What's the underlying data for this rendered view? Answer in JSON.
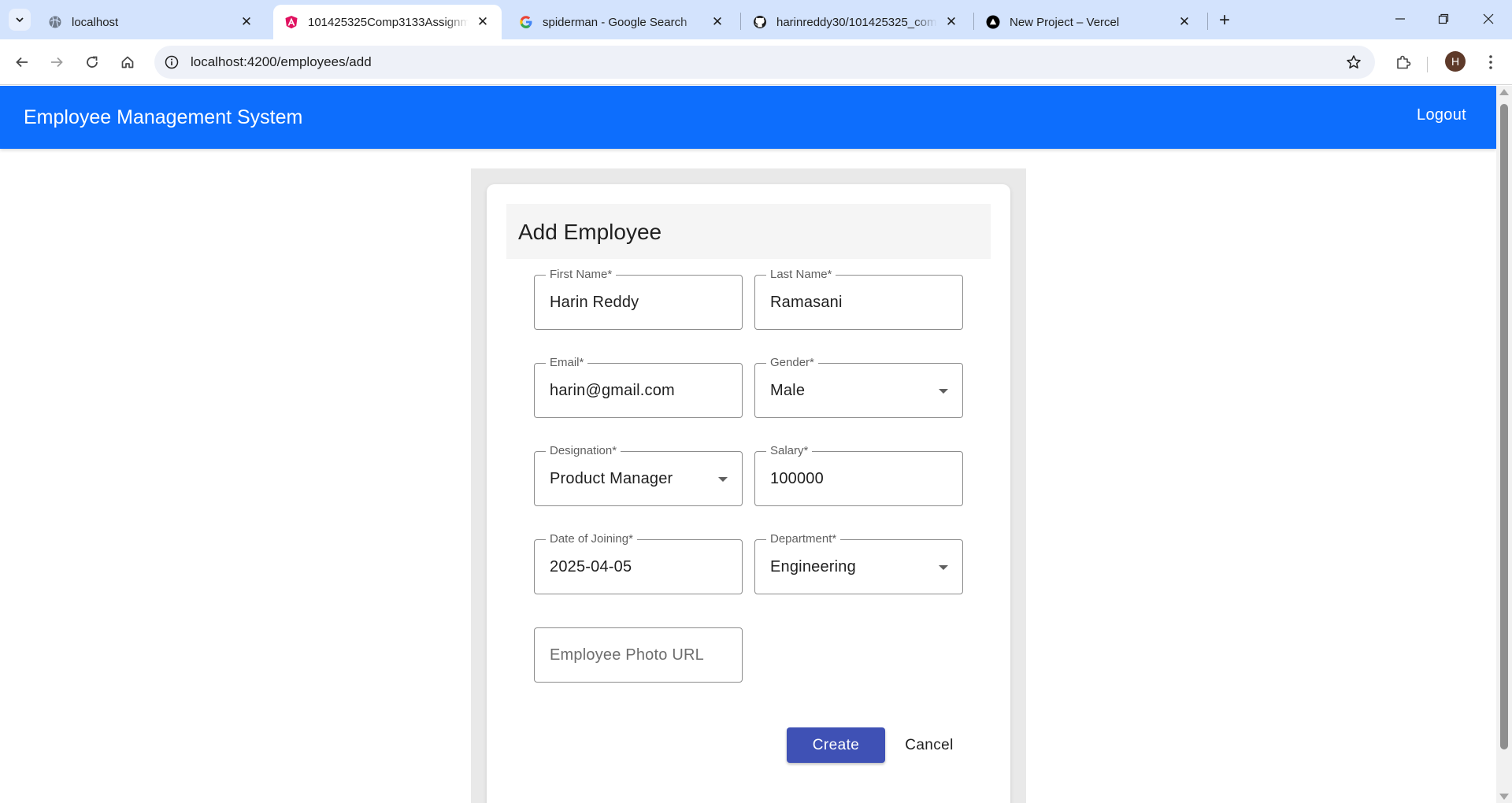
{
  "browser": {
    "tabs": [
      {
        "title": "localhost",
        "icon": "globe-icon",
        "active": false
      },
      {
        "title": "101425325Comp3133Assignme",
        "icon": "angular-icon",
        "active": true
      },
      {
        "title": "spiderman - Google Search",
        "icon": "google-icon",
        "active": false
      },
      {
        "title": "harinreddy30/101425325_comp",
        "icon": "github-icon",
        "active": false
      },
      {
        "title": "New Project – Vercel",
        "icon": "vercel-icon",
        "active": false
      }
    ],
    "url": "localhost:4200/employees/add",
    "profile_initial": "H",
    "tab_strip_color": "#d3e3fd"
  },
  "app": {
    "title": "Employee Management System",
    "logout_label": "Logout",
    "nav_color": "#0d6efd"
  },
  "form": {
    "heading": "Add Employee",
    "fields": {
      "first_name": {
        "label": "First Name*",
        "value": "Harin Reddy"
      },
      "last_name": {
        "label": "Last Name*",
        "value": "Ramasani"
      },
      "email": {
        "label": "Email*",
        "value": "harin@gmail.com"
      },
      "gender": {
        "label": "Gender*",
        "value": "Male"
      },
      "designation": {
        "label": "Designation*",
        "value": "Product Manager"
      },
      "salary": {
        "label": "Salary*",
        "value": "100000"
      },
      "date_of_joining": {
        "label": "Date of Joining*",
        "value": "2025-04-05"
      },
      "department": {
        "label": "Department*",
        "value": "Engineering"
      },
      "photo_url": {
        "placeholder": "Employee Photo URL",
        "value": ""
      }
    },
    "create_label": "Create",
    "cancel_label": "Cancel",
    "primary_color": "#3f51b5"
  }
}
